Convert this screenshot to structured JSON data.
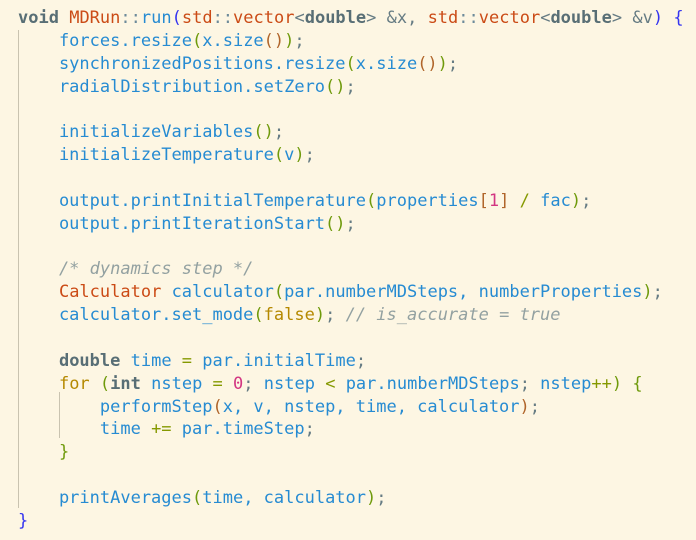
{
  "editor": {
    "theme_colors": {
      "background": "#fdf6e3",
      "identifier": "#268bd2",
      "type": "#cb4b16",
      "keyword": "#586e75",
      "comment": "#93a1a1",
      "number": "#d33682",
      "constant": "#b58900"
    },
    "lines": [
      [
        [
          "kw",
          "void"
        ],
        [
          "p",
          " "
        ],
        [
          "type",
          "MDRun"
        ],
        [
          "sep",
          "::"
        ],
        [
          "fn",
          "run"
        ],
        [
          "b1",
          "("
        ],
        [
          "type",
          "std"
        ],
        [
          "sep",
          "::"
        ],
        [
          "type",
          "vector"
        ],
        [
          "p",
          "<"
        ],
        [
          "kw",
          "double"
        ],
        [
          "p",
          "> &x, "
        ],
        [
          "type",
          "std"
        ],
        [
          "sep",
          "::"
        ],
        [
          "type",
          "vector"
        ],
        [
          "p",
          "<"
        ],
        [
          "kw",
          "double"
        ],
        [
          "p",
          "> &v"
        ],
        [
          "b1",
          ")"
        ],
        [
          "p",
          " "
        ],
        [
          "b1",
          "{"
        ]
      ],
      [
        [
          "id",
          "    forces.resize"
        ],
        [
          "b2",
          "("
        ],
        [
          "id",
          "x.size"
        ],
        [
          "b3",
          "()"
        ],
        [
          "b2",
          ")"
        ],
        [
          "p",
          ";"
        ]
      ],
      [
        [
          "id",
          "    synchronizedPositions.resize"
        ],
        [
          "b2",
          "("
        ],
        [
          "id",
          "x.size"
        ],
        [
          "b3",
          "()"
        ],
        [
          "b2",
          ")"
        ],
        [
          "p",
          ";"
        ]
      ],
      [
        [
          "id",
          "    radialDistribution.setZero"
        ],
        [
          "b2",
          "()"
        ],
        [
          "p",
          ";"
        ]
      ],
      [],
      [
        [
          "id",
          "    initializeVariables"
        ],
        [
          "b2",
          "()"
        ],
        [
          "p",
          ";"
        ]
      ],
      [
        [
          "id",
          "    initializeTemperature"
        ],
        [
          "b2",
          "("
        ],
        [
          "id",
          "v"
        ],
        [
          "b2",
          ")"
        ],
        [
          "p",
          ";"
        ]
      ],
      [],
      [
        [
          "id",
          "    output.printInitialTemperature"
        ],
        [
          "b2",
          "("
        ],
        [
          "id",
          "properties"
        ],
        [
          "b3",
          "["
        ],
        [
          "num",
          "1"
        ],
        [
          "b3",
          "]"
        ],
        [
          "p",
          " "
        ],
        [
          "op",
          "/"
        ],
        [
          "p",
          " "
        ],
        [
          "id",
          "fac"
        ],
        [
          "b2",
          ")"
        ],
        [
          "p",
          ";"
        ]
      ],
      [
        [
          "id",
          "    output.printIterationStart"
        ],
        [
          "b2",
          "()"
        ],
        [
          "p",
          ";"
        ]
      ],
      [],
      [
        [
          "cm",
          "    /* dynamics step */"
        ]
      ],
      [
        [
          "p",
          "    "
        ],
        [
          "type",
          "Calculator"
        ],
        [
          "p",
          " "
        ],
        [
          "id",
          "calculator"
        ],
        [
          "b2",
          "("
        ],
        [
          "id",
          "par.numberMDSteps, numberProperties"
        ],
        [
          "b2",
          ")"
        ],
        [
          "p",
          ";"
        ]
      ],
      [
        [
          "id",
          "    calculator.set_mode"
        ],
        [
          "b2",
          "("
        ],
        [
          "const",
          "false"
        ],
        [
          "b2",
          ")"
        ],
        [
          "p",
          "; "
        ],
        [
          "cm",
          "// is_accurate = true"
        ]
      ],
      [],
      [
        [
          "p",
          "    "
        ],
        [
          "kw",
          "double"
        ],
        [
          "id",
          " time "
        ],
        [
          "op",
          "="
        ],
        [
          "id",
          " par.initialTime"
        ],
        [
          "p",
          ";"
        ]
      ],
      [
        [
          "p",
          "    "
        ],
        [
          "ctl",
          "for"
        ],
        [
          "p",
          " "
        ],
        [
          "b2",
          "("
        ],
        [
          "kw",
          "int"
        ],
        [
          "id",
          " nstep "
        ],
        [
          "op",
          "="
        ],
        [
          "p",
          " "
        ],
        [
          "num",
          "0"
        ],
        [
          "p",
          "; "
        ],
        [
          "id",
          "nstep "
        ],
        [
          "op",
          "<"
        ],
        [
          "id",
          " par.numberMDSteps"
        ],
        [
          "p",
          "; "
        ],
        [
          "id",
          "nstep"
        ],
        [
          "op",
          "++"
        ],
        [
          "b2",
          ")"
        ],
        [
          "p",
          " "
        ],
        [
          "b2",
          "{"
        ]
      ],
      [
        [
          "id",
          "        performStep"
        ],
        [
          "b3",
          "("
        ],
        [
          "id",
          "x, v, nstep, time, calculator"
        ],
        [
          "b3",
          ")"
        ],
        [
          "p",
          ";"
        ]
      ],
      [
        [
          "id",
          "        time "
        ],
        [
          "op",
          "+="
        ],
        [
          "id",
          " par.timeStep"
        ],
        [
          "p",
          ";"
        ]
      ],
      [
        [
          "p",
          "    "
        ],
        [
          "b2",
          "}"
        ]
      ],
      [],
      [
        [
          "id",
          "    printAverages"
        ],
        [
          "b2",
          "("
        ],
        [
          "id",
          "time, calculator"
        ],
        [
          "b2",
          ")"
        ],
        [
          "p",
          ";"
        ]
      ],
      [
        [
          "b1",
          "}"
        ]
      ]
    ]
  }
}
